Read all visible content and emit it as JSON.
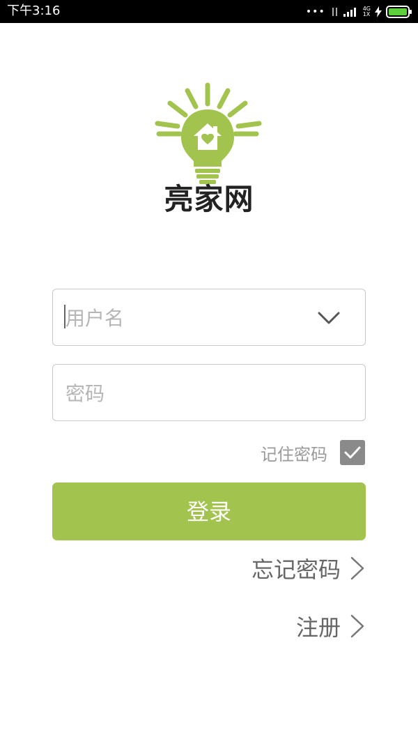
{
  "status_bar": {
    "time": "下午3:16",
    "network_top": "4G",
    "network_bottom": "1X",
    "colors": {
      "battery": "#5ccf3a"
    }
  },
  "brand": {
    "name": "亮家网",
    "logo_color": "#a2c44f"
  },
  "login_form": {
    "username_placeholder": "用户名",
    "password_placeholder": "密码",
    "remember_label": "记住密码",
    "remember_checked": true,
    "login_label": "登录"
  },
  "links": {
    "forgot_label": "忘记密码",
    "register_label": "注册"
  },
  "colors": {
    "accent": "#a2c44f",
    "checkbox": "#8a8a8a"
  },
  "icons": {
    "dropdown": "chevron-down-icon",
    "forward": "chevron-right-icon",
    "check": "check-icon",
    "logo": "lightbulb-house-icon"
  }
}
